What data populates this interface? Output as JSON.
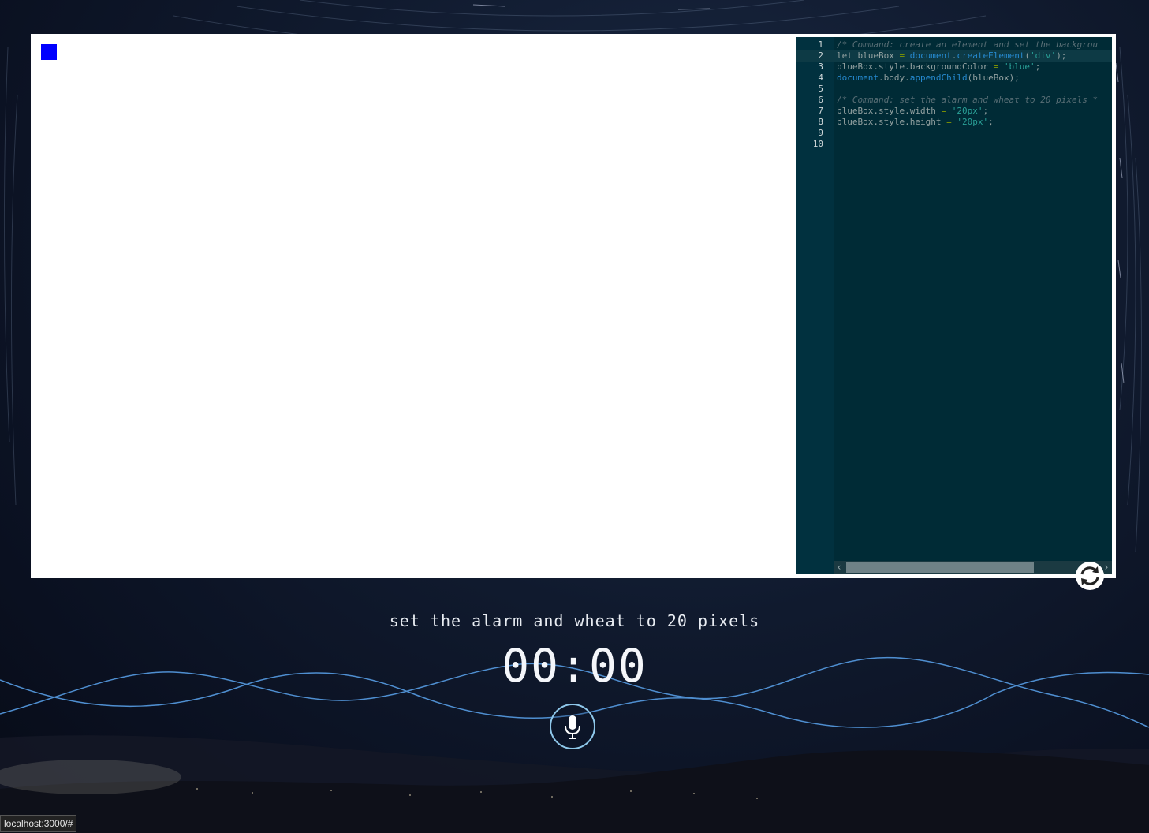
{
  "editor": {
    "lines": [
      {
        "num": "1",
        "parts": [
          {
            "t": "/* Command: create an element and set the backgrou",
            "c": "comment"
          }
        ]
      },
      {
        "num": "2",
        "active": true,
        "parts": [
          {
            "t": "let blueBox ",
            "c": "plain"
          },
          {
            "t": "=",
            "c": "op"
          },
          {
            "t": " ",
            "c": "plain"
          },
          {
            "t": "document",
            "c": "builtin"
          },
          {
            "t": ".",
            "c": "plain"
          },
          {
            "t": "createElement",
            "c": "builtin"
          },
          {
            "t": "(",
            "c": "plain"
          },
          {
            "t": "'div'",
            "c": "string"
          },
          {
            "t": ");",
            "c": "plain"
          }
        ]
      },
      {
        "num": "3",
        "parts": [
          {
            "t": "blueBox.style.backgroundColor ",
            "c": "plain"
          },
          {
            "t": "=",
            "c": "op"
          },
          {
            "t": " ",
            "c": "plain"
          },
          {
            "t": "'blue'",
            "c": "string"
          },
          {
            "t": ";",
            "c": "plain"
          }
        ]
      },
      {
        "num": "4",
        "parts": [
          {
            "t": "document",
            "c": "builtin"
          },
          {
            "t": ".body.",
            "c": "plain"
          },
          {
            "t": "appendChild",
            "c": "builtin"
          },
          {
            "t": "(blueBox);",
            "c": "plain"
          }
        ]
      },
      {
        "num": "5",
        "parts": []
      },
      {
        "num": "6",
        "parts": [
          {
            "t": "/* Command: set the alarm and wheat to 20 pixels *",
            "c": "comment"
          }
        ]
      },
      {
        "num": "7",
        "parts": [
          {
            "t": "blueBox.style.width ",
            "c": "plain"
          },
          {
            "t": "=",
            "c": "op"
          },
          {
            "t": " ",
            "c": "plain"
          },
          {
            "t": "'20px'",
            "c": "string"
          },
          {
            "t": ";",
            "c": "plain"
          }
        ]
      },
      {
        "num": "8",
        "parts": [
          {
            "t": "blueBox.style.height ",
            "c": "plain"
          },
          {
            "t": "=",
            "c": "op"
          },
          {
            "t": " ",
            "c": "plain"
          },
          {
            "t": "'20px'",
            "c": "string"
          },
          {
            "t": ";",
            "c": "plain"
          }
        ]
      },
      {
        "num": "9",
        "parts": []
      },
      {
        "num": "10",
        "parts": []
      }
    ],
    "scroll_left_arrow": "‹",
    "scroll_right_arrow": "›"
  },
  "preview": {
    "box_color": "#0000ff"
  },
  "voice": {
    "command_text": "set the alarm and wheat to 20 pixels",
    "timer": "00:00"
  },
  "icons": {
    "refresh": "refresh-icon",
    "mic": "microphone-icon"
  },
  "status_bar": {
    "url": "localhost:3000/#"
  }
}
